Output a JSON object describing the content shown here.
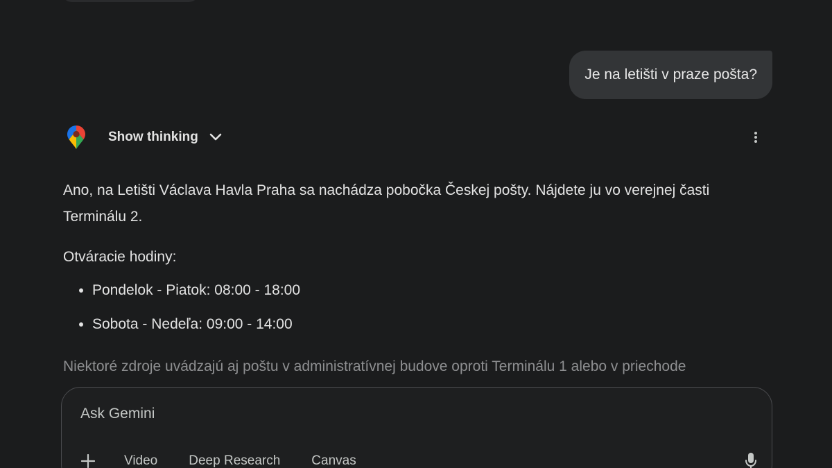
{
  "conversation": {
    "user_message": "Je na letišti v praze pošta?",
    "response": {
      "source_icon": "google-maps-icon",
      "show_thinking_label": "Show thinking",
      "intro": "Ano, na Letišti Václava Havla Praha sa nachádza pobočka Českej pošty. Nájdete ju vo verejnej časti Terminálu 2.",
      "hours_heading": "Otváracie hodiny:",
      "hours": [
        "Pondelok - Piatok: 08:00 - 18:00",
        "Sobota - Nedeľa: 09:00 - 14:00"
      ],
      "trailing_text": "Niektoré zdroje uvádzajú aj poštu v administratívnej budove oproti Terminálu 1 alebo v priechode"
    }
  },
  "composer": {
    "placeholder": "Ask Gemini",
    "tools": {
      "video": "Video",
      "deep_research": "Deep Research",
      "canvas": "Canvas"
    }
  },
  "colors": {
    "background": "#1b1c1d",
    "bubble": "#333537",
    "text": "#e3e3e3",
    "muted_text": "#8e8f91"
  }
}
